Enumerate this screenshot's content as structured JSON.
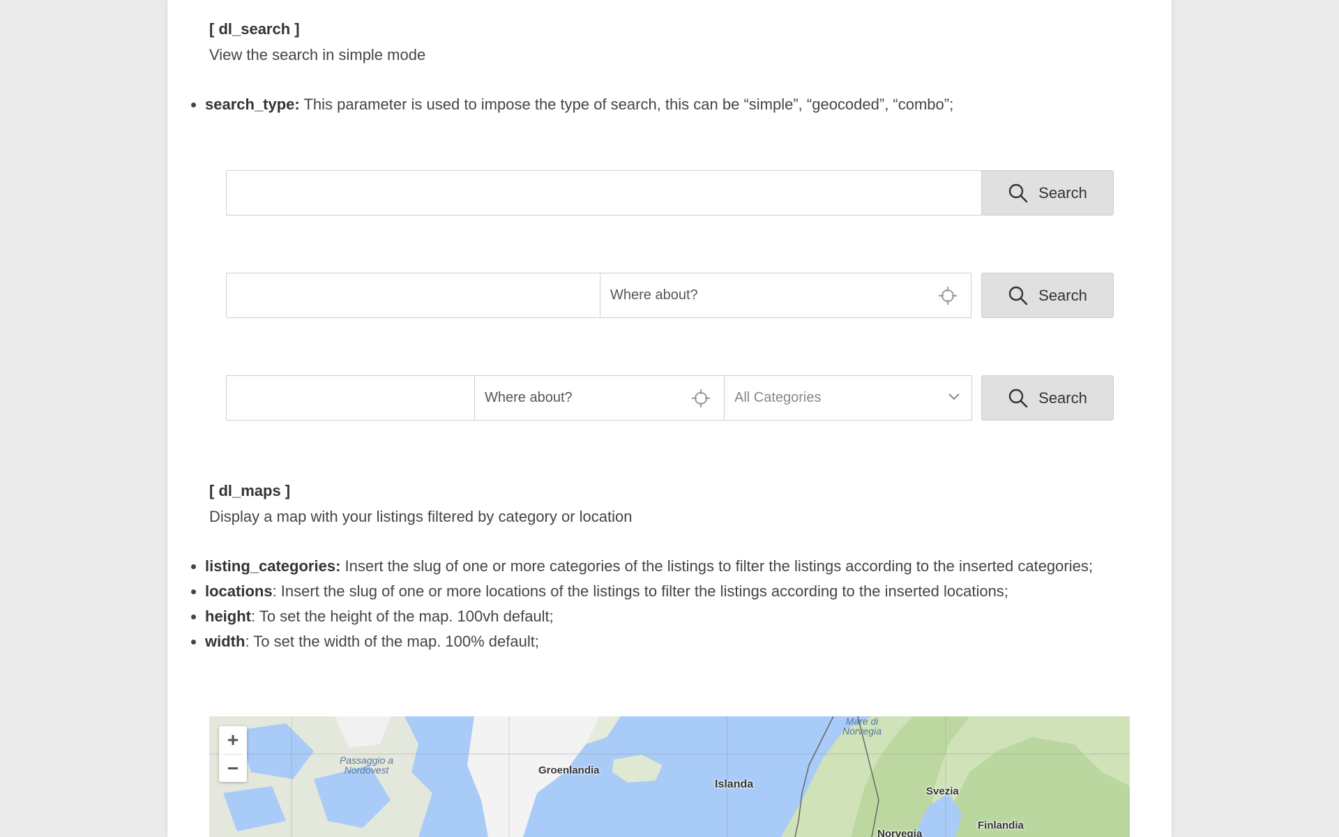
{
  "dl_search": {
    "title": "[ dl_search ]",
    "description": "View the search in simple mode",
    "params": [
      {
        "name": "search_type:",
        "text": " This parameter is used to impose the type of search, this can be “simple”, “geocoded”, “combo”;"
      }
    ]
  },
  "search_simple": {
    "button_label": "Search"
  },
  "search_geocoded": {
    "location_placeholder": "Where about?",
    "button_label": "Search"
  },
  "search_combo": {
    "location_placeholder": "Where about?",
    "category_value": "All Categories",
    "button_label": "Search"
  },
  "dl_maps": {
    "title": "[ dl_maps ]",
    "description": "Display a map with your listings filtered by category or location",
    "params": [
      {
        "name": "listing_categories:",
        "text": " Insert the slug of one or more categories of the listings to filter the listings according to the inserted categories;"
      },
      {
        "name": "locations",
        "text": ": Insert the slug of one or more locations of the listings to filter the listings according to the inserted locations;"
      },
      {
        "name": "height",
        "text": ": To set the height of the map. 100vh default;"
      },
      {
        "name": "width",
        "text": ": To set the width of the map. 100% default;"
      }
    ]
  },
  "map": {
    "zoom_in": "+",
    "zoom_out": "−",
    "labels": {
      "passaggio": "Passaggio a\nNordovest",
      "groenlandia": "Groenlandia",
      "islanda": "Islanda",
      "mare_norvegia": "Mare di\nNorvegia",
      "svezia": "Svezia",
      "finlandia": "Finlandia",
      "norvegia": "Norvegia"
    },
    "colors": {
      "water": "#a9cbf7",
      "land": "#dfe8d2",
      "ice": "#f2f2f2",
      "forest": "#b8d8a0"
    }
  }
}
